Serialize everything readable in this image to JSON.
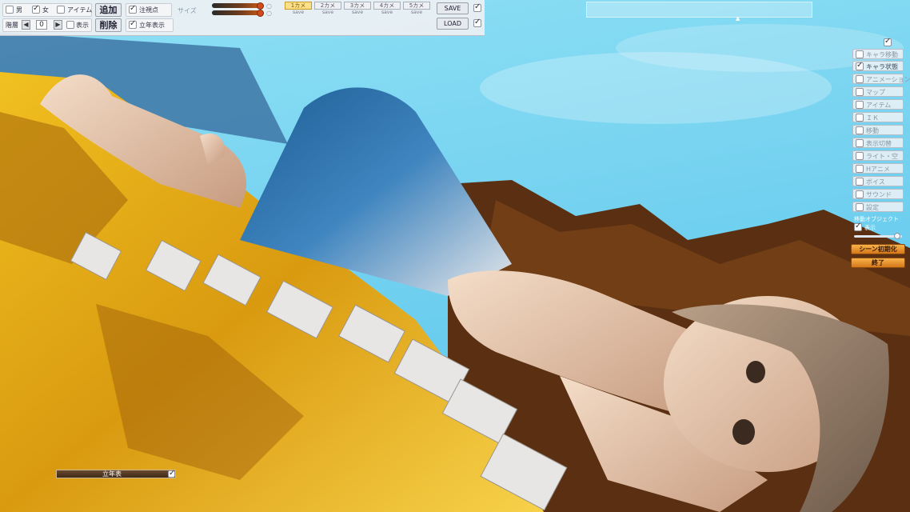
{
  "toolbar": {
    "sex_male": "男",
    "sex_female": "女",
    "item": "アイテム",
    "add": "追加",
    "delete": "削除",
    "gaze_label": "注視点",
    "standing_label": "立年表示",
    "layer_label": "階層",
    "layer_value": "0",
    "display_label": "表示",
    "speed_label": "サイズ",
    "slots": [
      "1カメ",
      "2カメ",
      "3カメ",
      "4カメ",
      "5カメ"
    ],
    "slot_save": "save",
    "save": "SAVE",
    "load": "LOAD"
  },
  "right_panel": {
    "items": [
      {
        "label": "キャラ移動",
        "checked": false
      },
      {
        "label": "キャラ状態",
        "checked": true
      },
      {
        "label": "アニメーション",
        "checked": false
      },
      {
        "label": "マップ",
        "checked": false
      },
      {
        "label": "アイテム",
        "checked": false
      },
      {
        "label": "ＩＫ",
        "checked": false
      },
      {
        "label": "移動",
        "checked": false
      },
      {
        "label": "表示切替",
        "checked": false
      },
      {
        "label": "ライト・空",
        "checked": false
      },
      {
        "label": "Hアニメ",
        "checked": false
      },
      {
        "label": "ボイス",
        "checked": false
      },
      {
        "label": "サウンド",
        "checked": false
      },
      {
        "label": "設定",
        "checked": false
      }
    ],
    "move_object_label": "移動オブジェクト",
    "show_label": "表示",
    "scene_init": "シーン初期化",
    "exit": "終了"
  },
  "bottom": {
    "label": "立年表"
  },
  "colors": {
    "sky": "#7fd3ee",
    "sand": "#e8b21a",
    "rock": "#5b2f12",
    "accent_orange": "#e8902a"
  }
}
